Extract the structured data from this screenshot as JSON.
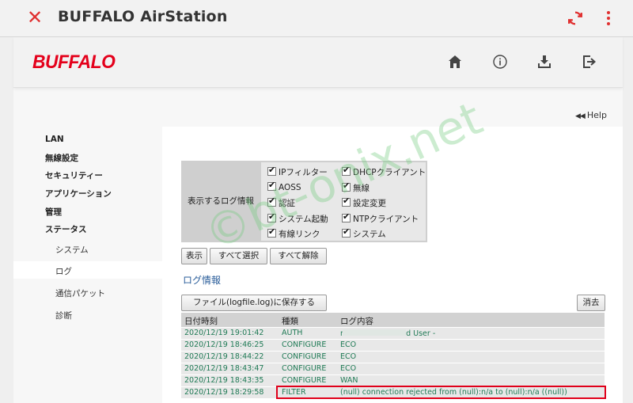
{
  "appbar": {
    "title": "BUFFALO AirStation",
    "close_icon": "close-icon",
    "refresh_icon": "refresh-icon",
    "menu_icon": "more-vert-icon"
  },
  "header": {
    "logo": "BUFFALO",
    "icons": [
      "home-icon",
      "info-icon",
      "download-icon",
      "logout-icon"
    ]
  },
  "help": {
    "label": "Help",
    "arrows": "◀◀"
  },
  "sidebar": {
    "items": [
      {
        "label": "LAN"
      },
      {
        "label": "無線設定"
      },
      {
        "label": "セキュリティー"
      },
      {
        "label": "アプリケーション"
      },
      {
        "label": "管理"
      },
      {
        "label": "ステータス"
      }
    ],
    "sub_items": [
      {
        "label": "システム"
      },
      {
        "label": "ログ"
      },
      {
        "label": "通信パケット"
      },
      {
        "label": "診断"
      }
    ],
    "active": "ログ"
  },
  "filter": {
    "label": "表示するログ情報",
    "options": [
      {
        "label": "IPフィルター",
        "checked": true
      },
      {
        "label": "DHCPクライアント",
        "checked": true
      },
      {
        "label": "AOSS",
        "checked": true
      },
      {
        "label": "無線",
        "checked": true
      },
      {
        "label": "認証",
        "checked": true
      },
      {
        "label": "設定変更",
        "checked": true
      },
      {
        "label": "システム起動",
        "checked": true
      },
      {
        "label": "NTPクライアント",
        "checked": true
      },
      {
        "label": "有線リンク",
        "checked": true
      },
      {
        "label": "システム",
        "checked": true
      }
    ]
  },
  "buttons": {
    "show": "表示",
    "select_all": "すべて選択",
    "deselect_all": "すべて解除",
    "save": "ファイル(logfile.log)に保存する",
    "clear": "消去"
  },
  "log": {
    "title": "ログ情報",
    "headers": [
      "日付時刻",
      "種類",
      "ログ内容"
    ],
    "rows": [
      {
        "time": "2020/12/19 19:01:42",
        "type": "AUTH",
        "content": "ra0: Authenticated User -"
      },
      {
        "time": "2020/12/19 18:46:25",
        "type": "CONFIGURE",
        "content": "ECO"
      },
      {
        "time": "2020/12/19 18:44:22",
        "type": "CONFIGURE",
        "content": "ECO"
      },
      {
        "time": "2020/12/19 18:43:47",
        "type": "CONFIGURE",
        "content": "ECO"
      },
      {
        "time": "2020/12/19 18:43:35",
        "type": "CONFIGURE",
        "content": "WAN"
      },
      {
        "time": "2020/12/19 18:29:58",
        "type": "FILTER",
        "content": "(null) connection rejected from (null):n/a to (null):n/a ((null))"
      }
    ],
    "highlight_color": "#e0001b"
  },
  "watermark": "©bt-onix.net",
  "colors": {
    "accent": "#e03030",
    "link": "#2a5d9a",
    "log_text": "#1f7a55"
  }
}
